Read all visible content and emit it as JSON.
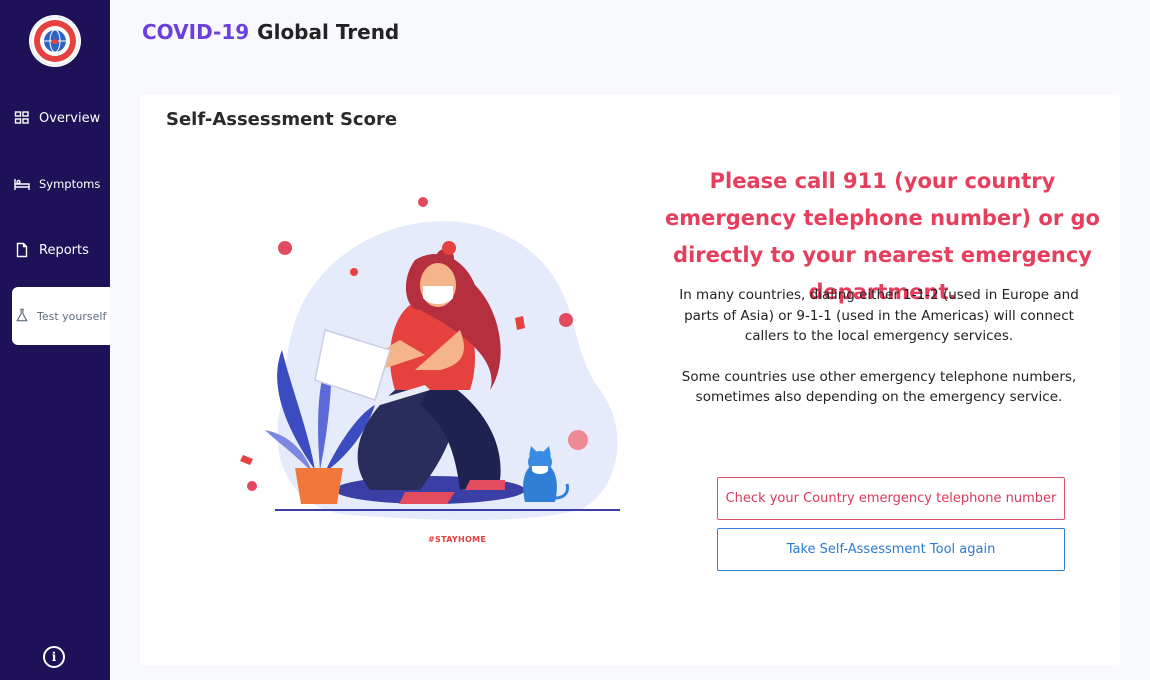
{
  "app": {
    "header_accent": "COVID-19",
    "header_title": "Global Trend",
    "logo_icon": "stay-home-world-logo"
  },
  "sidebar": {
    "items": [
      {
        "label": "Overview",
        "icon": "grid-icon"
      },
      {
        "label": "Symptoms",
        "icon": "bed-icon"
      },
      {
        "label": "Reports",
        "icon": "document-icon"
      },
      {
        "label": "Test yourself",
        "icon": "flask-icon",
        "active": true
      }
    ],
    "info_icon": "info-icon"
  },
  "card": {
    "title": "Self-Assessment Score",
    "alert": "Please call 911 (your country emergency telephone number) or go directly to your nearest emergency department.",
    "paragraph1": "In many countries, dialing either 1-1-2 (used in Europe and parts of Asia) or 9-1-1 (used in the Americas) will connect callers to the local emergency services.",
    "paragraph2": "Some countries use other emergency telephone numbers, sometimes also depending on the emergency service.",
    "illustration_caption": "#STAYHOME",
    "buttons": {
      "check_number": "Check your Country emergency telephone number",
      "retake": "Take Self-Assessment Tool again"
    }
  },
  "colors": {
    "sidebar_bg": "#1e1158",
    "accent_purple": "#6b3fe0",
    "alert_red": "#e63e5c",
    "button_blue": "#2a7ad2"
  }
}
